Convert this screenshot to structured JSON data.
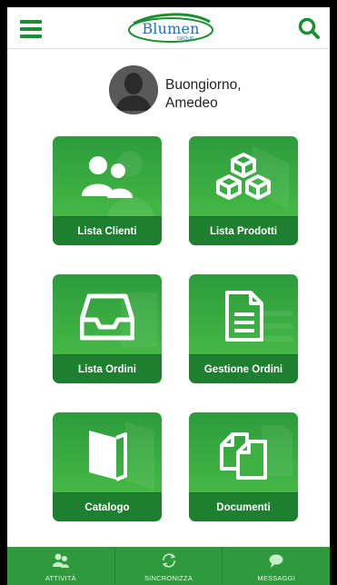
{
  "header": {
    "logo_text": "Blumen",
    "logo_sub": "GROUP",
    "menu_icon": "hamburger-icon",
    "search_icon": "search-icon"
  },
  "greeting": {
    "line1": "Buongiorno,",
    "line2": "Amedeo"
  },
  "tiles": [
    {
      "label": "Lista Clienti",
      "icon": "users-icon"
    },
    {
      "label": "Lista Prodotti",
      "icon": "boxes-icon"
    },
    {
      "label": "Lista Ordini",
      "icon": "inbox-tray-icon"
    },
    {
      "label": "Gestione Ordini",
      "icon": "document-list-icon"
    },
    {
      "label": "Catalogo",
      "icon": "book-icon"
    },
    {
      "label": "Documenti",
      "icon": "documents-icon"
    }
  ],
  "bottom_bar": [
    {
      "label": "ATTIVITÀ",
      "icon": "users-icon"
    },
    {
      "label": "SINCRONIZZA",
      "icon": "sync-icon"
    },
    {
      "label": "MESSAGGI",
      "icon": "chat-bubble-icon"
    }
  ],
  "colors": {
    "brand_green": "#1a8f2e",
    "tile_gradient_top": "#2d9b3c",
    "tile_gradient_bottom": "#4cc349",
    "tile_label_bar": "#1f7f30",
    "logo_blue": "#1a6fbf",
    "bottom_bar": "#2f9a3d"
  }
}
